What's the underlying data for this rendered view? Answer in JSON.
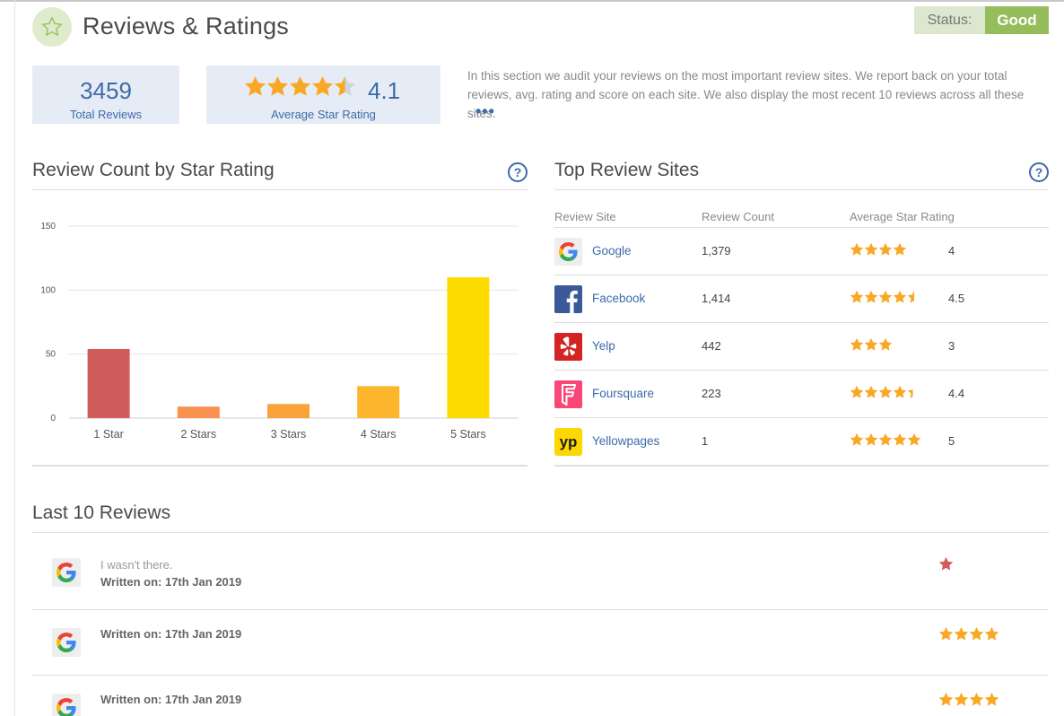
{
  "header": {
    "title": "Reviews & Ratings",
    "icon": "star-outline-icon",
    "status_label": "Status:",
    "status_value": "Good"
  },
  "summary": {
    "total_reviews": "3459",
    "total_reviews_label": "Total Reviews",
    "average_rating": "4.1",
    "average_rating_label": "Average Star Rating",
    "intro": "In this section we audit your reviews on the most important review sites. We report back on your total reviews, avg. rating and score on each site. We also display the most recent 10 reviews across all these sites.",
    "more": "•••"
  },
  "chart_section": {
    "title": "Review Count by Star Rating",
    "help": "?"
  },
  "chart_data": {
    "type": "bar",
    "categories": [
      "1 Star",
      "2 Stars",
      "3 Stars",
      "4 Stars",
      "5 Stars"
    ],
    "values": [
      54,
      9,
      11,
      25,
      110
    ],
    "colors": [
      "#d05c5c",
      "#f9914f",
      "#f9a23a",
      "#fdb52b",
      "#ffdc00"
    ],
    "yticks": [
      0,
      50,
      100,
      150
    ],
    "ylim": [
      0,
      150
    ],
    "title": "",
    "xlabel": "",
    "ylabel": "",
    "grid": true
  },
  "sites_section": {
    "title": "Top Review Sites",
    "help": "?",
    "col_site": "Review Site",
    "col_count": "Review Count",
    "col_rating": "Average Star Rating",
    "sites": [
      {
        "name": "Google",
        "count": "1,379",
        "rating": "4",
        "stars": 4,
        "icon": "google-logo-icon"
      },
      {
        "name": "Facebook",
        "count": "1,414",
        "rating": "4.5",
        "stars": 4.5,
        "icon": "facebook-logo-icon"
      },
      {
        "name": "Yelp",
        "count": "442",
        "rating": "3",
        "stars": 3,
        "icon": "yelp-logo-icon"
      },
      {
        "name": "Foursquare",
        "count": "223",
        "rating": "4.4",
        "stars": 4.4,
        "icon": "foursquare-logo-icon"
      },
      {
        "name": "Yellowpages",
        "count": "1",
        "rating": "5",
        "stars": 5,
        "icon": "yellowpages-logo-icon"
      }
    ]
  },
  "reviews_section": {
    "title": "Last 10 Reviews",
    "reviews": [
      {
        "text": "I wasn't there.",
        "date": "Written on: 17th Jan 2019",
        "stars": 1,
        "source": "google"
      },
      {
        "text": "",
        "date": "Written on: 17th Jan 2019",
        "stars": 4,
        "source": "google"
      },
      {
        "text": "",
        "date": "Written on: 17th Jan 2019",
        "stars": 4,
        "source": "google"
      }
    ]
  },
  "colors": {
    "accent_blue": "#3d6aa9",
    "star_orange": "#f9a825",
    "status_green": "#95bd5c",
    "one_star_red": "#d05c5c"
  }
}
